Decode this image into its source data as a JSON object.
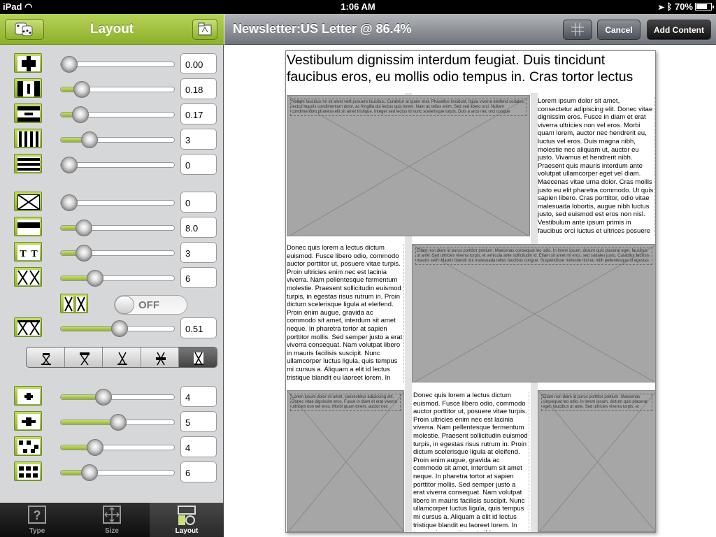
{
  "status_bar": {
    "device": "iPad",
    "time": "1:06 AM",
    "battery": "70%"
  },
  "left_panel": {
    "title": "Layout",
    "rows_group1": [
      {
        "icon": "page-margins-icon",
        "value": "0.00",
        "level": 0.0
      },
      {
        "icon": "column-margins-icon",
        "value": "0.18",
        "level": 0.18
      },
      {
        "icon": "row-margins-icon",
        "value": "0.17",
        "level": 0.17
      },
      {
        "icon": "columns-icon",
        "value": "3",
        "level": 0.25
      },
      {
        "icon": "rows-icon",
        "value": "0",
        "level": 0.0
      }
    ],
    "rows_group2": [
      {
        "icon": "image-placeholder-icon",
        "value": "0",
        "level": 0.0
      },
      {
        "icon": "headline-bar-icon",
        "value": "8.0",
        "level": 0.2
      },
      {
        "icon": "text-columns-icon",
        "value": "3",
        "level": 0.2
      },
      {
        "icon": "cross-columns-icon",
        "value": "6",
        "level": 0.3
      }
    ],
    "toggle": {
      "icon": "split-columns-icon",
      "label": "OFF"
    },
    "row_density": {
      "icon": "density-icon",
      "value": "0.51",
      "level": 0.51
    },
    "segments": [
      "align-top-icon",
      "align-top-bar-icon",
      "align-center-icon",
      "align-middle-bar-icon",
      "align-bottom-icon"
    ],
    "selected_segment": 4,
    "rows_group3": [
      {
        "icon": "grid-center-icon",
        "value": "4",
        "level": 0.37
      },
      {
        "icon": "grid-wide-icon",
        "value": "5",
        "level": 0.5
      },
      {
        "icon": "grid-dots-icon",
        "value": "4",
        "level": 0.3
      },
      {
        "icon": "grid-blocks-icon",
        "value": "6",
        "level": 0.25
      }
    ],
    "tabs": [
      {
        "label": "Type",
        "icon": "question-icon"
      },
      {
        "label": "Size",
        "icon": "resize-icon"
      },
      {
        "label": "Layout",
        "icon": "layout-icon"
      }
    ],
    "selected_tab": 2
  },
  "right_panel": {
    "title": "Newsletter:US Letter @ 86.4%",
    "buttons": {
      "grid": "grid-icon",
      "cancel": "Cancel",
      "add": "Add Content"
    },
    "headline": "Vestibulum dignissim interdum feugiat. Duis tincidunt faucibus eros, eu mollis odio tempus in. Cras tortor lectus",
    "caption1": "Nullam faucibus mi sit amet velit posuere faucibus. Curabitur at quam erat. Phasellus tincidunt, ligula viverra eleifend sodales, lectus mauris condimentum dolor, ac fringilla dui lectus quis lorem. Nam ac tellus enim. Sed sed libero orci. Nullam condimentum pharetra elit sit amet tristique. Integer sed lectus id nunc scelerisque turpis. Duis a arcu nec orci congue",
    "caption2": "Etiam non diam id purus porttitor pretium. Maecenas consequat leo odio. In lorem ipsum, dictum quis placerat eget, faucibus ut ante. Sed ultricies viverra turpis, et vehicula ante sollicitudin id. Etiam sit amet mi eros, sed sodales justo. Curabitur facilisis mauris sem. Mauris blandit dui malesuada tellus faucibus congue. Suspendisse molestie nisl eu nibh pellentesque id egestas",
    "caption3": "Lorem ipsum dolor sit amet, consectetur adipiscing elit. Donec vitae dignissim eros. Fusce in diam et erat viverra ultricies non vel eros. Morbi quam lorem, auctor nec",
    "caption4": "Etiam non diam id purus porttitor pretium. Maecenas consequat leo odio. In lorem ipsum, dictum quis placerat eget, faucibus ut ante. Sed ultricies viverra turpis, et",
    "text_right": "Lorem ipsum dolor sit amet, consectetur adipiscing elit. Donec vitae dignissim eros. Fusce in diam et erat viverra ultricies non vel eros. Morbi quam lorem, auctor nec hendrerit eu, luctus vel eros. Duis magna nibh, molestie nec aliquam ut, auctor eu justo. Vivamus et hendrerit nibh. Praesent quis mauris interdum ante volutpat ullamcorper eget vel diam. Maecenas vitae urna dolor. Cras mollis justo eu elit pharetra commodo. Ut quis sapien libero. Cras porttitor, odio vitae malesuada lobortis, augue nibh luctus justo, sed euismod est eros non nisl. Vestibulum ante ipsum primis in faucibus orci luctus et ultrices posuere cubilia Curae; Quisque pharetra neque vitae ante tincidunt malesuada. Integer quam massa, convallis",
    "text_left": "Donec quis lorem a lectus dictum euismod. Fusce libero odio, commodo auctor porttitor ut, posuere vitae turpis. Proin ultricies enim nec est lacinia viverra. Nam pellentesque fermentum molestie. Praesent sollicitudin euismod turpis, in egestas risus rutrum in. Proin dictum scelerisque ligula at eleifend. Proin enim augue, gravida ac commodo sit amet, interdum sit amet neque. In pharetra tortor at sapien porttitor mollis. Sed semper justo a erat viverra consequat. Nam volutpat libero in mauris facilisis suscipit. Nunc ullamcorper luctus ligula, quis tempus mi cursus a. Aliquam a elit id lectus tristique blandit eu laoreet lorem. In tempor ipsum sit amet nibh pellentesque ullamcorper. Nullam convallis scelerisque ipsum sed condimentum. Nulla non feugiat velit. Nunc",
    "text_bottom": "Donec quis lorem a lectus dictum euismod. Fusce libero odio, commodo auctor porttitor ut, posuere vitae turpis. Proin ultricies enim nec est lacinia viverra. Nam pellentesque fermentum molestie. Praesent sollicitudin euismod turpis, in egestas risus rutrum in. Proin dictum scelerisque ligula at eleifend. Proin enim augue, gravida ac commodo sit amet, interdum sit amet neque. In pharetra tortor at sapien porttitor mollis. Sed semper justo a erat viverra consequat. Nam volutpat libero in mauris facilisis suscipit. Nunc ullamcorper luctus ligula, quis tempus mi cursus a. Aliquam a elit id lectus tristique blandit eu laoreet lorem. In tempor ipsum sit amet nibh pellentesque ullamcorper. Nullam convallis scelerisque ipsum sed condimentum. Nulla non feugiat velit. Nunc"
  },
  "colors": {
    "accent_green": "#9cc03a",
    "toolbar_gray": "#8a8f94",
    "placeholder_gray": "#a6a6a6"
  }
}
